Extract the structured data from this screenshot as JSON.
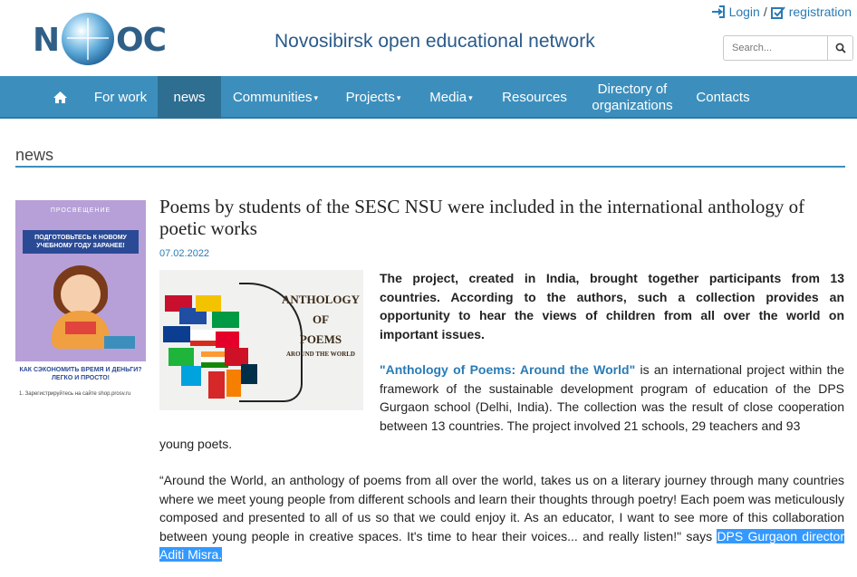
{
  "header": {
    "logo_left": "N",
    "logo_right": "OC",
    "site_title": "Novosibirsk open educational network",
    "login_label": "Login",
    "separator": "/",
    "registration_label": "registration",
    "search_placeholder": "Search..."
  },
  "nav": {
    "items": [
      {
        "label": "For work"
      },
      {
        "label": "news"
      },
      {
        "label": "Communities"
      },
      {
        "label": "Projects"
      },
      {
        "label": "Media"
      },
      {
        "label": "Resources"
      },
      {
        "label": "Directory of organizations"
      },
      {
        "label": "Contacts"
      }
    ],
    "active": "news",
    "caret": "▾"
  },
  "section": {
    "heading": "news"
  },
  "ad": {
    "brand": "ПРОСВЕЩЕНИЕ",
    "banner": "ПОДГОТОВЬТЕСЬ К НОВОМУ УЧЕБНОМУ ГОДУ ЗАРАНЕЕ!",
    "question": "КАК СЭКОНОМИТЬ ВРЕМЯ И ДЕНЬГИ? ЛЕГКО И ПРОСТО!",
    "register": "1. Зарегистрируйтесь на сайте shop.prosv.ru"
  },
  "article": {
    "title": "Poems by students of the SESC NSU were included in the international anthology of poetic works",
    "date": "07.02.2022",
    "image": {
      "line1": "ANTHOLOGY",
      "line2": "OF",
      "line3": "POEMS",
      "line4": "AROUND THE WORLD"
    },
    "lead": "The project, created in India, brought together participants from 13 countries. According to the authors, such a collection provides an opportunity to hear the views of children from all over the world on important issues.",
    "para2_highlight": "\"Anthology of Poems: Around the World\"",
    "para2_body": " is an international project within the framework of the sustainable development program of education of the DPS Gurgaon school (Delhi, India). The collection was the result of close cooperation between 13 countries. The project involved 21 schools, 29 teachers and 93",
    "para2_tail": "young poets.",
    "quote_body": "“Around the World, an anthology of poems from all over the world, takes us on a literary journey through many countries where we meet young people from different schools and learn their thoughts through poetry! Each poem was meticulously composed and presented to all of us so that we could enjoy it. As an educator, I want to see more of this collaboration between young people in creative spaces. It's time to hear their voices... and really listen!\" says ",
    "quote_selected": "DPS Gurgaon director Aditi Misra."
  },
  "colors": {
    "nav_bg": "#3c8fbd",
    "nav_active": "#2d6e91",
    "link": "#2a7bb5",
    "selection": "#3399ff"
  },
  "icons": {
    "home": "home-icon",
    "login": "sign-in-icon",
    "registration": "edit-checkbox-icon",
    "search": "search-icon"
  }
}
